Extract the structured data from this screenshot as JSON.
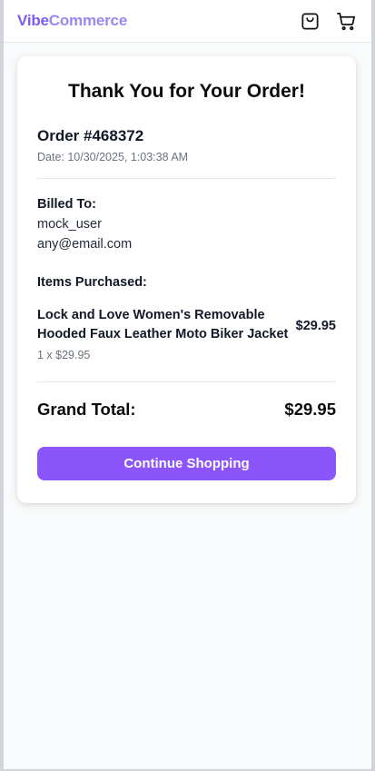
{
  "header": {
    "brand_part1": "Vibe",
    "brand_part2": "Commerce",
    "icons": [
      "shopping-bag-icon",
      "shopping-cart-icon"
    ]
  },
  "confirmation": {
    "title": "Thank You for Your Order!",
    "order_number": "Order #468372",
    "date": "Date: 10/30/2025, 1:03:38 AM",
    "billed_label": "Billed To:",
    "billed_name": "mock_user",
    "billed_email": "any@email.com",
    "items_label": "Items Purchased:",
    "items": [
      {
        "name": "Lock and Love Women's Removable Hooded Faux Leather Moto Biker Jacket",
        "qty_line": "1 x $29.95",
        "price": "$29.95"
      }
    ],
    "total_label": "Grand Total:",
    "total_value": "$29.95",
    "cta_label": "Continue Shopping"
  },
  "colors": {
    "brand_primary": "#7c5cf0",
    "brand_secondary": "#9b87f5",
    "cta_background": "#8b55fb",
    "page_background": "#f9fafb"
  }
}
